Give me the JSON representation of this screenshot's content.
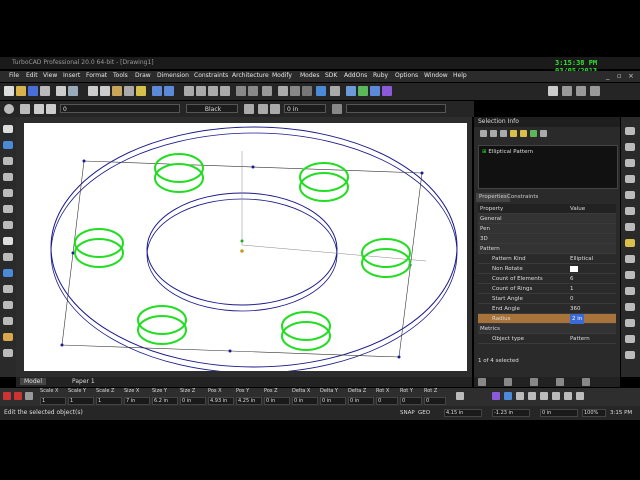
{
  "window": {
    "title": "TurboCAD Professional 20.0 64-bit - [Drawing1]"
  },
  "clock": "3:15:38 PM 03/05/2013",
  "menu": [
    "File",
    "Edit",
    "View",
    "Insert",
    "Format",
    "Tools",
    "Draw",
    "Dimension",
    "Constraints",
    "Architecture",
    "Modify",
    "Modes",
    "SDK",
    "AddOns",
    "Ruby",
    "Options",
    "Window",
    "Help"
  ],
  "toolbar2": {
    "layer_value": "0",
    "color_value": "Black",
    "thickness_value": "0 in"
  },
  "selection_info": {
    "header": "Selection Info",
    "item": "Elliptical Pattern"
  },
  "properties": {
    "tab_properties": "Properties",
    "tab_constraints": "Constraints",
    "col_property": "Property",
    "col_value": "Value",
    "rows": [
      {
        "name": "General",
        "value": "",
        "group": true
      },
      {
        "name": "Pen",
        "value": "",
        "group": true
      },
      {
        "name": "3D",
        "value": "",
        "group": true
      },
      {
        "name": "Pattern",
        "value": "",
        "group": true
      },
      {
        "name": "Pattern Kind",
        "value": "Elliptical"
      },
      {
        "name": "Non Rotate",
        "value": ""
      },
      {
        "name": "Count of Elements",
        "value": "6"
      },
      {
        "name": "Count of Rings",
        "value": "1"
      },
      {
        "name": "Start Angle",
        "value": "0"
      },
      {
        "name": "End Angle",
        "value": "360"
      },
      {
        "name": "Radius",
        "value": "2 in",
        "highlight": true
      },
      {
        "name": "Metrics",
        "value": "",
        "group": true
      },
      {
        "name": "Object type",
        "value": "Pattern"
      }
    ],
    "footer": "1 of 4 selected"
  },
  "bottom_tabs": {
    "model": "Model",
    "paper": "Paper 1"
  },
  "inspector": [
    {
      "label": "Scale X",
      "value": "1"
    },
    {
      "label": "Scale Y",
      "value": "1"
    },
    {
      "label": "Scale Z",
      "value": "1"
    },
    {
      "label": "Size X",
      "value": "7 in"
    },
    {
      "label": "Size Y",
      "value": "6.2 in"
    },
    {
      "label": "Size Z",
      "value": "0 in"
    },
    {
      "label": "Pos X",
      "value": "4.93 in"
    },
    {
      "label": "Pos Y",
      "value": "4.25 in"
    },
    {
      "label": "Pos Z",
      "value": "0 in"
    },
    {
      "label": "Delta X",
      "value": "0 in"
    },
    {
      "label": "Delta Y",
      "value": "0 in"
    },
    {
      "label": "Delta Z",
      "value": "0 in"
    },
    {
      "label": "Rot X",
      "value": "0"
    },
    {
      "label": "Rot Y",
      "value": "0"
    },
    {
      "label": "Rot Z",
      "value": "0"
    }
  ],
  "status": {
    "prompt": "Edit the selected object(s)",
    "snap": "SNAP",
    "geo": "GEO",
    "coord_x": "4.15 in",
    "coord_y": "-1.23 in",
    "coord_z": "0 in",
    "zoom": "100%",
    "time": "3:15 PM"
  },
  "colors": {
    "accent_green": "#2ee62e",
    "pattern_ring": "#22dd22",
    "drawing_line": "#1a1a8c",
    "highlight": "#a8733a"
  }
}
